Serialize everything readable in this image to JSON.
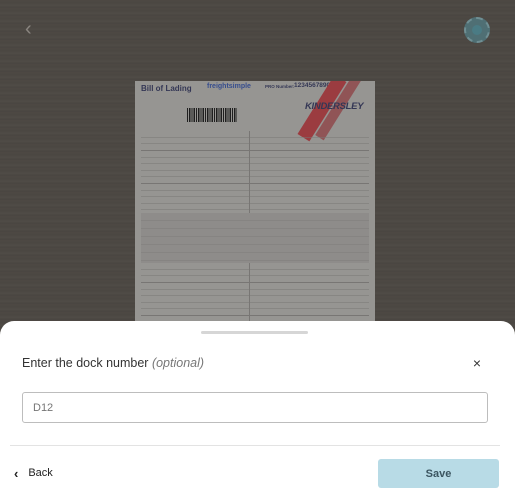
{
  "background": {
    "document": {
      "title": "Bill of Lading",
      "brand": "freightsimple",
      "pro_label": "PRO Number:",
      "pro_number": "1234567890",
      "carrier_logo": "KINDERSLEY"
    },
    "icons": {
      "back": "chevron-left-icon",
      "camera": "camera-shutter-icon"
    }
  },
  "sheet": {
    "title": "Enter the dock number ",
    "title_optional": "(optional)",
    "close_label": "×",
    "dock_input": {
      "value": "",
      "placeholder": "D12"
    },
    "back_label": "Back",
    "back_icon": "‹",
    "save_label": "Save"
  },
  "colors": {
    "save_button": "#b8dbe6",
    "sheet_bg": "#ffffff"
  }
}
